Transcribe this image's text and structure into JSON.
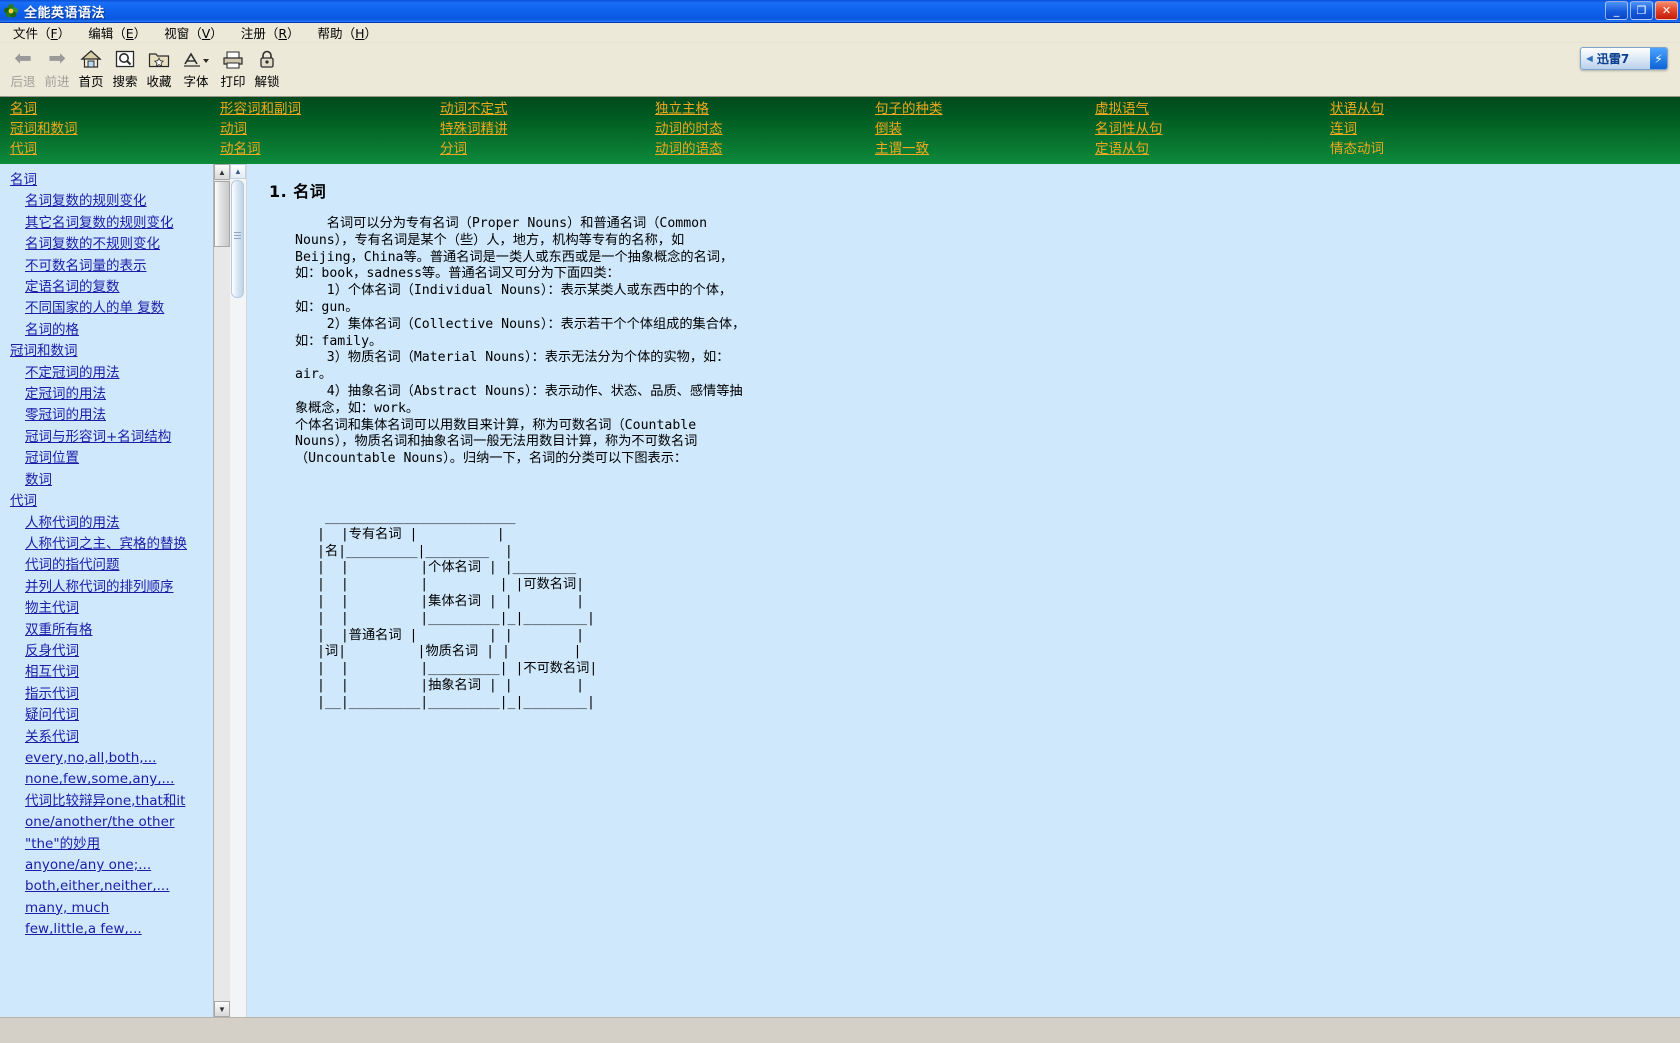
{
  "window": {
    "title": "全能英语语法",
    "app_icon": "flower-icon",
    "buttons": {
      "minimize": "_",
      "maximize": "❐",
      "close": "✕"
    }
  },
  "menubar": {
    "items": [
      {
        "label": "文件",
        "accel": "F"
      },
      {
        "label": "编辑",
        "accel": "E"
      },
      {
        "label": "视窗",
        "accel": "V"
      },
      {
        "label": "注册",
        "accel": "R"
      },
      {
        "label": "帮助",
        "accel": "H"
      }
    ]
  },
  "toolbar": {
    "items": [
      {
        "label": "后退",
        "icon": "back-arrow-icon",
        "disabled": true
      },
      {
        "label": "前进",
        "icon": "forward-arrow-icon",
        "disabled": true
      },
      {
        "label": "首页",
        "icon": "home-icon",
        "disabled": false
      },
      {
        "label": "搜索",
        "icon": "search-icon",
        "disabled": false
      },
      {
        "label": "收藏",
        "icon": "favorites-folder-icon",
        "disabled": false
      },
      {
        "label": "字体",
        "icon": "font-icon",
        "disabled": false
      },
      {
        "label": "打印",
        "icon": "printer-icon",
        "disabled": false
      },
      {
        "label": "解锁",
        "icon": "lock-icon",
        "disabled": false
      }
    ],
    "badge": {
      "back_glyph": "◄",
      "label": "迅雷7",
      "bolt": "⚡"
    }
  },
  "nav": {
    "columns": [
      {
        "links": [
          "名词",
          "冠词和数词",
          "代词"
        ]
      },
      {
        "links": [
          "形容词和副词",
          "动词",
          "动名词"
        ]
      },
      {
        "links": [
          "动词不定式",
          "特殊词精讲",
          "分词"
        ]
      },
      {
        "links": [
          "独立主格",
          "动词的时态",
          "动词的语态"
        ]
      },
      {
        "links": [
          "句子的种类",
          "倒装",
          "主谓一致"
        ]
      },
      {
        "links": [
          "虚拟语气",
          "名词性从句",
          "定语从句"
        ]
      },
      {
        "links": [
          "状语从句",
          "连词",
          "情态动词"
        ]
      }
    ]
  },
  "sidebar": {
    "items": [
      {
        "label": "名词",
        "level": 0
      },
      {
        "label": "名词复数的规则变化",
        "level": 1
      },
      {
        "label": "其它名词复数的规则变化",
        "level": 1
      },
      {
        "label": "名词复数的不规则变化",
        "level": 1
      },
      {
        "label": "不可数名词量的表示",
        "level": 1
      },
      {
        "label": "定语名词的复数",
        "level": 1
      },
      {
        "label": "不同国家的人的单 复数",
        "level": 1
      },
      {
        "label": "名词的格",
        "level": 1
      },
      {
        "label": "冠词和数词",
        "level": 0
      },
      {
        "label": "不定冠词的用法",
        "level": 1
      },
      {
        "label": "定冠词的用法",
        "level": 1
      },
      {
        "label": "零冠词的用法",
        "level": 1
      },
      {
        "label": "冠词与形容词+名词结构",
        "level": 1
      },
      {
        "label": "冠词位置",
        "level": 1
      },
      {
        "label": "数词",
        "level": 1
      },
      {
        "label": "代词",
        "level": 0
      },
      {
        "label": "人称代词的用法",
        "level": 1
      },
      {
        "label": "人称代词之主、宾格的替换",
        "level": 1
      },
      {
        "label": "代词的指代问题",
        "level": 1
      },
      {
        "label": "并列人称代词的排列顺序",
        "level": 1
      },
      {
        "label": "物主代词",
        "level": 1
      },
      {
        "label": "双重所有格",
        "level": 1
      },
      {
        "label": "反身代词",
        "level": 1
      },
      {
        "label": "相互代词",
        "level": 1
      },
      {
        "label": "指示代词",
        "level": 1
      },
      {
        "label": "疑问代词",
        "level": 1
      },
      {
        "label": "关系代词",
        "level": 1
      },
      {
        "label": "every,no,all,both,...",
        "level": 1
      },
      {
        "label": "none,few,some,any,...",
        "level": 1
      },
      {
        "label": "代词比较辩异one,that和it",
        "level": 1
      },
      {
        "label": "one/another/the other",
        "level": 1
      },
      {
        "label": "\"the\"的妙用",
        "level": 1
      },
      {
        "label": "anyone/any one;...",
        "level": 1
      },
      {
        "label": "both,either,neither,...",
        "level": 1
      },
      {
        "label": "many, much",
        "level": 1
      },
      {
        "label": "few,little,a few,...",
        "level": 1
      }
    ],
    "scroll_up": "▲",
    "scroll_down": "▼"
  },
  "content": {
    "heading": "1. 名词",
    "body": "    名词可以分为专有名词（Proper Nouns）和普通名词（Common\nNouns），专有名词是某个（些）人，地方，机构等专有的名称，如\nBeijing，China等。普通名词是一类人或东西或是一个抽象概念的名词，\n如：book，sadness等。普通名词又可分为下面四类：\n    1）个体名词（Individual Nouns）：表示某类人或东西中的个体，\n如：gun。\n    2）集体名词（Collective Nouns）：表示若干个个体组成的集合体，\n如：family。\n    3）物质名词（Material Nouns）：表示无法分为个体的实物，如：\nair。\n    4）抽象名词（Abstract Nouns）：表示动作、状态、品质、感情等抽\n象概念，如：work。\n个体名词和集体名词可以用数目来计算，称为可数名词（Countable\nNouns），物质名词和抽象名词一般无法用数目计算，称为不可数名词\n（Uncountable Nouns）。归纳一下，名词的分类可以下图表示：",
    "ascii_table": " ________________________\n|  |专有名词 |          |\n|名|_________|________  |\n|  |         |个体名词 | |________\n|  |         |         | |可数名词|\n|  |         |集体名词 | |        |\n|  |         |_________|_|________|\n|  |普通名词 |         | |        |\n|词|         |物质名词 | |        |\n|  |         |_________| |不可数名词|\n|  |         |抽象名词 | |        |\n|__|_________|_________|_|________|"
  },
  "colors": {
    "title_blue": "#0f63ee",
    "nav_green": "#026324",
    "nav_link": "#f0a81e",
    "page_blue": "#cfe8fb",
    "link_blue": "#1d1da8",
    "chrome": "#ece9d8"
  }
}
